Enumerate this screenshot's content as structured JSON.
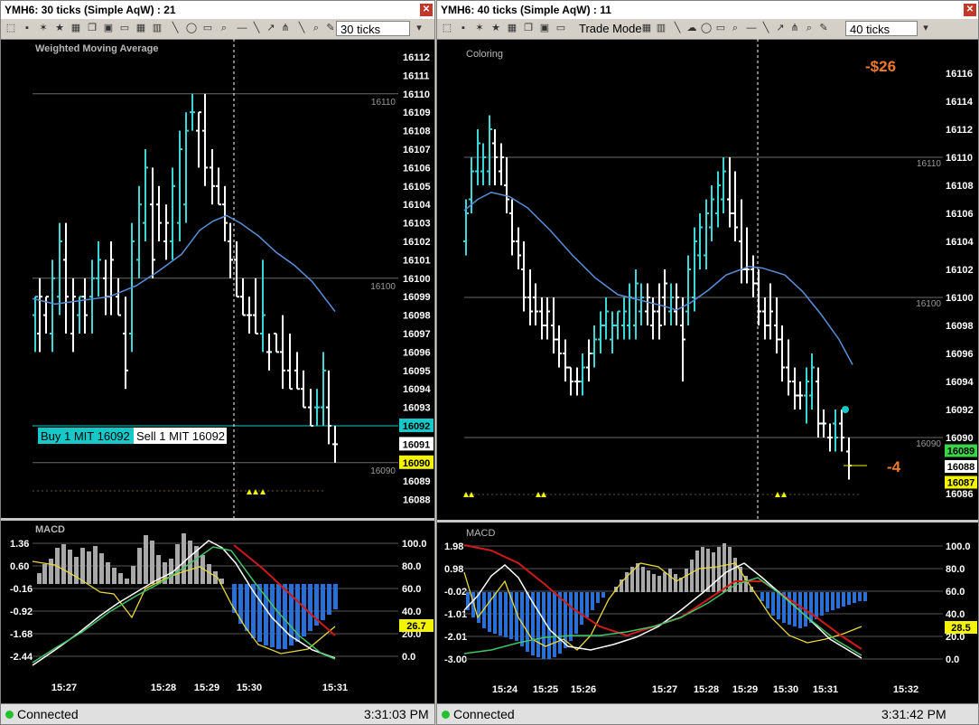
{
  "left": {
    "title": "YMH6: 30 ticks (Simple AqW) : 21",
    "ticks_field": "30 ticks",
    "indicator_label": "Weighted Moving Average",
    "price_axis": [
      "16112",
      "16111",
      "16110",
      "16109",
      "16108",
      "16107",
      "16106",
      "16105",
      "16104",
      "16103",
      "16102",
      "16101",
      "16100",
      "16099",
      "16098",
      "16097",
      "16096",
      "16095",
      "16094",
      "16093",
      "16092",
      "16091",
      "16090",
      "16089",
      "16088"
    ],
    "level_labels": [
      "16110",
      "16100",
      "16090"
    ],
    "buy_label": "Buy 1 MIT 16092",
    "sell_label": "Sell 1 MIT 16092",
    "price_tag_cyan": "16092",
    "price_tag_white": "16091",
    "price_tag_yellow": "16090",
    "macd_label": "MACD",
    "macd_left_axis": [
      "1.36",
      "0.60",
      "-0.16",
      "-0.92",
      "-1.68",
      "-2.44"
    ],
    "macd_right_axis": [
      "100.0",
      "80.0",
      "60.0",
      "40.0",
      "20.0",
      "0.0"
    ],
    "macd_tag": "26.7",
    "time_axis": [
      "15:27",
      "15:28",
      "15:29",
      "15:30",
      "15:31"
    ],
    "status": "Connected",
    "clock": "3:31:03 PM"
  },
  "right": {
    "title": "YMH6: 40 ticks (Simple AqW) : 11",
    "trade_mode": "Trade Mode",
    "ticks_field": "40 ticks",
    "indicator_label": "Coloring",
    "pnl": "-$26",
    "pnl_ticks": "-4",
    "price_axis": [
      "16116",
      "16114",
      "16112",
      "16110",
      "16108",
      "16106",
      "16104",
      "16102",
      "16100",
      "16098",
      "16096",
      "16094",
      "16092",
      "16090",
      "16088",
      "16086"
    ],
    "level_labels": [
      "16110",
      "16100",
      "16090"
    ],
    "price_tag_green": "16089",
    "price_tag_white": "16088",
    "price_tag_yellow": "16087",
    "macd_label": "MACD",
    "macd_left_axis": [
      "1.98",
      "0.98",
      "-0.02",
      "-1.01",
      "-2.01",
      "-3.00"
    ],
    "macd_right_axis": [
      "100.0",
      "80.0",
      "60.0",
      "40.0",
      "20.0",
      "0.0"
    ],
    "macd_tag": "28.5",
    "time_axis": [
      "15:24",
      "15:25",
      "15:26",
      "15:27",
      "15:28",
      "15:29",
      "15:30",
      "15:31",
      "15:32"
    ],
    "status": "Connected",
    "clock": "3:31:42 PM"
  },
  "colors": {
    "bar_up": "#3cd6d6",
    "bar_down": "#ffffff",
    "wma": "#5b8fd9",
    "histogram_pos": "#a8a8a8",
    "histogram_neg": "#2a6fd6",
    "macd_red": "#d01a1a",
    "macd_white": "#ffffff",
    "macd_green": "#41c464",
    "stoch_yellow": "#e8d83a",
    "accent_cyan": "#17c8c8",
    "pnl_orange": "#f07a2a",
    "tag_yellow": "#f4f400",
    "tag_green": "#3ad64a"
  }
}
